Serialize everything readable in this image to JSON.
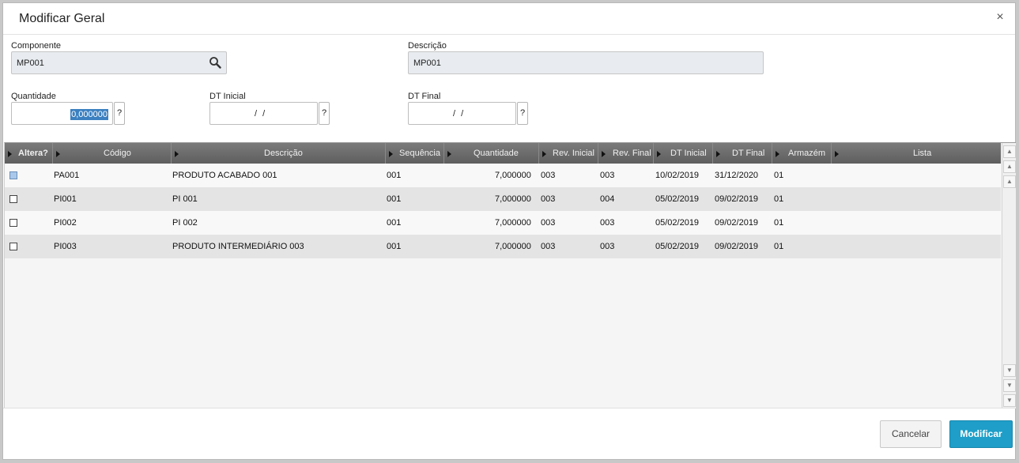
{
  "dialog": {
    "title": "Modificar Geral",
    "close": "×"
  },
  "form": {
    "componente_label": "Componente",
    "componente_value": "MP001",
    "descricao_label": "Descrição",
    "descricao_value": "MP001",
    "quantidade_label": "Quantidade",
    "quantidade_value": "0,000000",
    "dt_inicial_label": "DT Inicial",
    "dt_inicial_value": "/ /",
    "dt_final_label": "DT Final",
    "dt_final_value": "/ /",
    "help": "?"
  },
  "grid": {
    "columns": [
      "Altera?",
      "Código",
      "Descrição",
      "Sequência",
      "Quantidade",
      "Rev. Inicial",
      "Rev. Final",
      "DT Inicial",
      "DT Final",
      "Armazém",
      "Lista"
    ],
    "rows": [
      {
        "selected": true,
        "codigo": "PA001",
        "descricao": "PRODUTO ACABADO 001",
        "sequencia": "001",
        "quantidade": "7,000000",
        "rev_inicial": "003",
        "rev_final": "003",
        "dt_inicial": "10/02/2019",
        "dt_final": "31/12/2020",
        "armazem": "01",
        "lista": ""
      },
      {
        "selected": false,
        "codigo": "PI001",
        "descricao": "PI 001",
        "sequencia": "001",
        "quantidade": "7,000000",
        "rev_inicial": "003",
        "rev_final": "004",
        "dt_inicial": "05/02/2019",
        "dt_final": "09/02/2019",
        "armazem": "01",
        "lista": ""
      },
      {
        "selected": false,
        "codigo": "PI002",
        "descricao": "PI 002",
        "sequencia": "001",
        "quantidade": "7,000000",
        "rev_inicial": "003",
        "rev_final": "003",
        "dt_inicial": "05/02/2019",
        "dt_final": "09/02/2019",
        "armazem": "01",
        "lista": ""
      },
      {
        "selected": false,
        "codigo": "PI003",
        "descricao": "PRODUTO INTERMEDIÁRIO 003",
        "sequencia": "001",
        "quantidade": "7,000000",
        "rev_inicial": "003",
        "rev_final": "003",
        "dt_inicial": "05/02/2019",
        "dt_final": "09/02/2019",
        "armazem": "01",
        "lista": ""
      }
    ]
  },
  "buttons": {
    "cancel": "Cancelar",
    "modify": "Modificar"
  },
  "colors": {
    "header_bg": "#6b6b6b",
    "primary": "#1e9ec8",
    "row_alt": "#e4e4e4",
    "selection": "#3b80c0"
  }
}
